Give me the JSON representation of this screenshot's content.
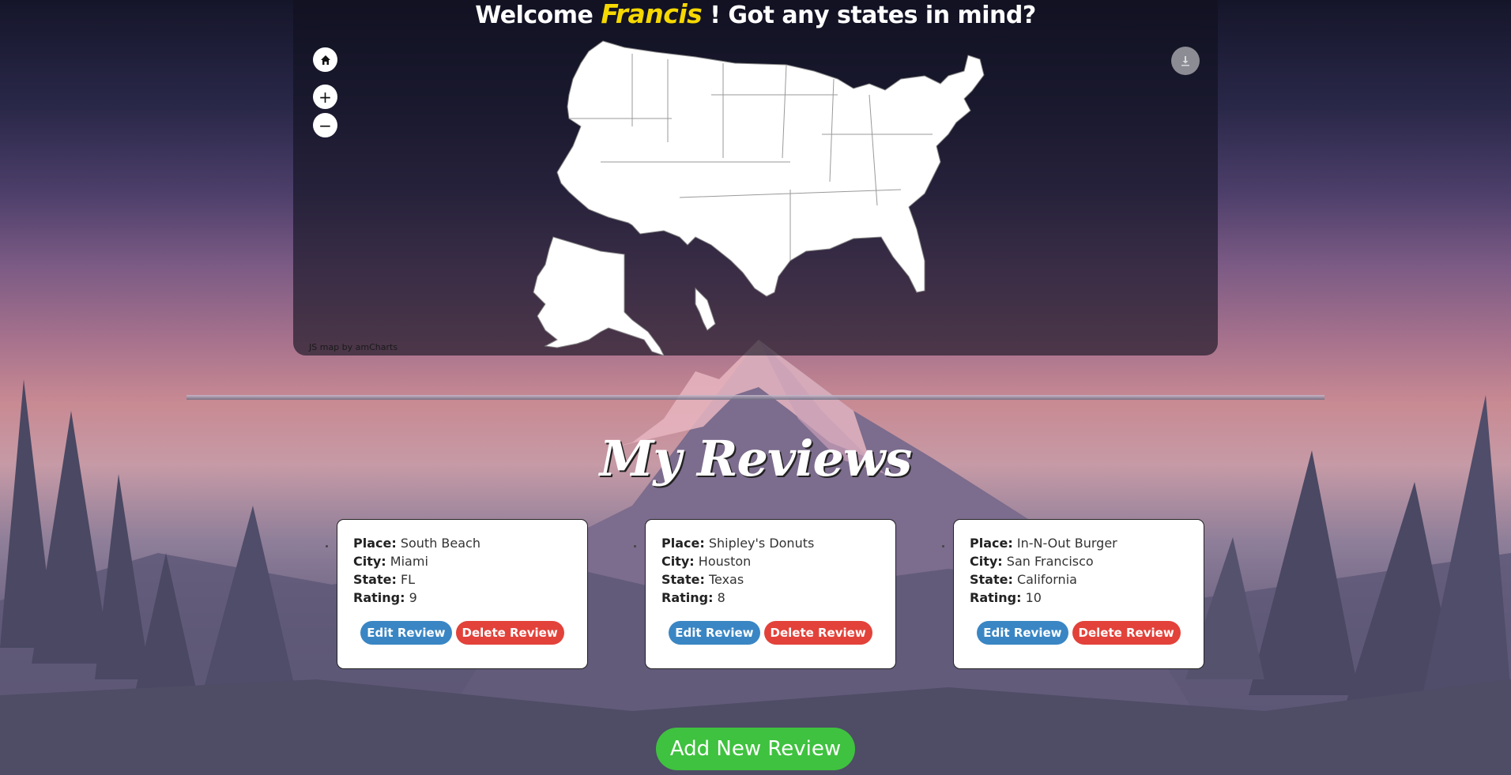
{
  "header": {
    "welcome_prefix": "Welcome",
    "user_name": "Francis",
    "welcome_suffix": "! Got any states in mind?"
  },
  "map": {
    "home_icon": "home-icon",
    "zoom_in_label": "+",
    "zoom_out_label": "−",
    "download_icon": "download-icon",
    "credit": "JS map by amCharts"
  },
  "section_title": "My Reviews",
  "reviews": [
    {
      "place_label": "Place:",
      "place": "South Beach",
      "city_label": "City:",
      "city": "Miami",
      "state_label": "State:",
      "state": "FL",
      "rating_label": "Rating:",
      "rating": "9",
      "edit_label": "Edit Review",
      "delete_label": "Delete Review"
    },
    {
      "place_label": "Place:",
      "place": "Shipley's Donuts",
      "city_label": "City:",
      "city": "Houston",
      "state_label": "State:",
      "state": "Texas",
      "rating_label": "Rating:",
      "rating": "8",
      "edit_label": "Edit Review",
      "delete_label": "Delete Review"
    },
    {
      "place_label": "Place:",
      "place": "In-N-Out Burger",
      "city_label": "City:",
      "city": "San Francisco",
      "state_label": "State:",
      "state": "California",
      "rating_label": "Rating:",
      "rating": "10",
      "edit_label": "Edit Review",
      "delete_label": "Delete Review"
    }
  ],
  "add_button_label": "Add New Review",
  "colors": {
    "username": "#f5d800",
    "edit_button": "#3a86c4",
    "delete_button": "#e2423a",
    "add_button": "#3fc23f"
  }
}
